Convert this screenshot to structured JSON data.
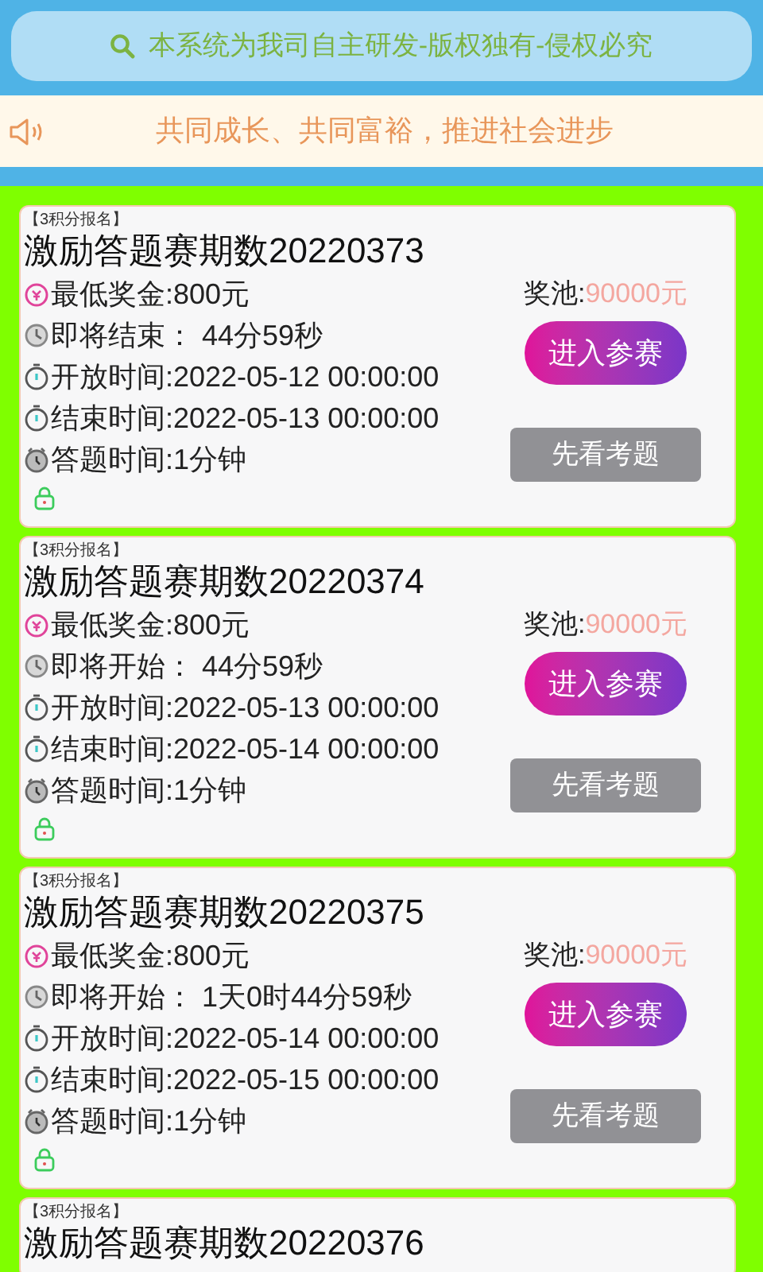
{
  "search_bar": {
    "text": "本系统为我司自主研发-版权独有-侵权必究"
  },
  "notice": {
    "text": "共同成长、共同富裕，推进社会进步"
  },
  "contests": [
    {
      "tag": "【3积分报名】",
      "title": "激励答题赛期数20220373",
      "min_prize": "最低奖金:800元",
      "countdown": "即将结束： 44分59秒",
      "open_time": "开放时间:2022-05-12 00:00:00",
      "close_time": "结束时间:2022-05-13 00:00:00",
      "answer_time": "答题时间:1分钟",
      "pool_label": "奖池:",
      "pool_value": "90000元",
      "join_button": "进入参赛",
      "preview_button": "先看考题"
    },
    {
      "tag": "【3积分报名】",
      "title": "激励答题赛期数20220374",
      "min_prize": "最低奖金:800元",
      "countdown": "即将开始： 44分59秒",
      "open_time": "开放时间:2022-05-13 00:00:00",
      "close_time": "结束时间:2022-05-14 00:00:00",
      "answer_time": "答题时间:1分钟",
      "pool_label": "奖池:",
      "pool_value": "90000元",
      "join_button": "进入参赛",
      "preview_button": "先看考题"
    },
    {
      "tag": "【3积分报名】",
      "title": "激励答题赛期数20220375",
      "min_prize": "最低奖金:800元",
      "countdown": "即将开始： 1天0时44分59秒",
      "open_time": "开放时间:2022-05-14 00:00:00",
      "close_time": "结束时间:2022-05-15 00:00:00",
      "answer_time": "答题时间:1分钟",
      "pool_label": "奖池:",
      "pool_value": "90000元",
      "join_button": "进入参赛",
      "preview_button": "先看考题"
    },
    {
      "tag": "【3积分报名】",
      "title": "激励答题赛期数20220376"
    }
  ]
}
